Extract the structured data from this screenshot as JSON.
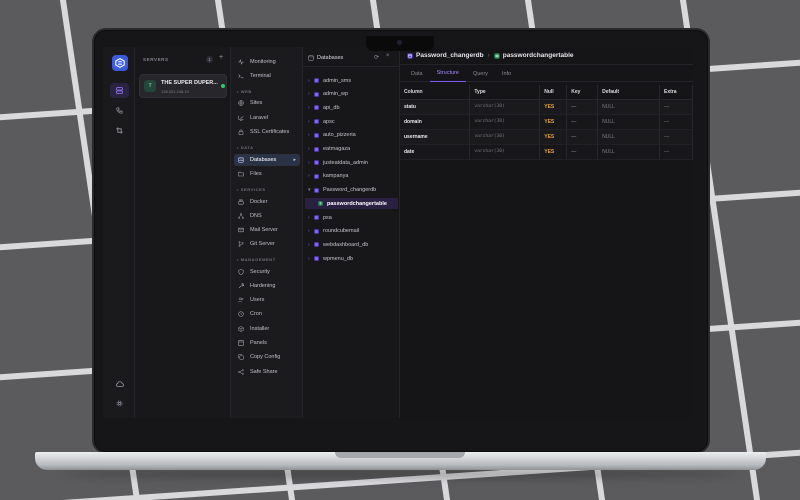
{
  "app": {
    "accent": "#7c5cff",
    "logo_icon": "stack-logo-icon"
  },
  "rail": {
    "items": [
      "servers-icon",
      "phone-icon",
      "crop-icon"
    ],
    "bottom": [
      "cloud-icon",
      "gear-icon"
    ]
  },
  "servers": {
    "title": "SERVERS",
    "count": "1",
    "add": "+",
    "server": {
      "initial": "T",
      "name": "THE SUPER DUPER...",
      "ip": "138.201.248.10",
      "status_color": "#2ecc71"
    }
  },
  "nav": {
    "monitoring": "Monitoring",
    "terminal": "Terminal",
    "section_web": "WEB",
    "sites": "Sites",
    "laravel": "Laravel",
    "ssl": "SSL Certificates",
    "section_data": "DATA",
    "databases": "Databases",
    "files": "Files",
    "section_services": "SERVICES",
    "docker": "Docker",
    "dns": "DNS",
    "mail": "Mail Server",
    "git": "Git Server",
    "section_management": "MANAGEMENT",
    "security": "Security",
    "hardening": "Hardening",
    "users": "Users",
    "cron": "Cron",
    "installer": "Installer",
    "panels": "Panels",
    "copy_config": "Copy Config",
    "safe_share": "Safe Share"
  },
  "databases": {
    "title": "Databases",
    "list": [
      "admin_sms",
      "admin_wp",
      "api_db",
      "apsc",
      "auto_pizzeria",
      "eatmagaza",
      "justeatdata_admin",
      "kampanya",
      "Password_changerdb",
      "passwordchangertable",
      "psa",
      "roundcubemail",
      "webdashboard_db",
      "wpmenu_db"
    ]
  },
  "main": {
    "crumb_db": "Password_changerdb",
    "crumb_table": "passwordchangertable",
    "tabs": [
      "Data",
      "Structure",
      "Query",
      "Info"
    ],
    "columns": [
      "Column",
      "Type",
      "Null",
      "Key",
      "Default",
      "Extra"
    ],
    "rows": [
      {
        "name": "statu",
        "type": "varchar(30)",
        "null": "YES",
        "key": "—",
        "default": "NULL",
        "extra": "—"
      },
      {
        "name": "domain",
        "type": "varchar(30)",
        "null": "YES",
        "key": "—",
        "default": "NULL",
        "extra": "—"
      },
      {
        "name": "username",
        "type": "varchar(30)",
        "null": "YES",
        "key": "—",
        "default": "NULL",
        "extra": "—"
      },
      {
        "name": "date",
        "type": "varchar(30)",
        "null": "YES",
        "key": "—",
        "default": "NULL",
        "extra": "—"
      }
    ]
  }
}
